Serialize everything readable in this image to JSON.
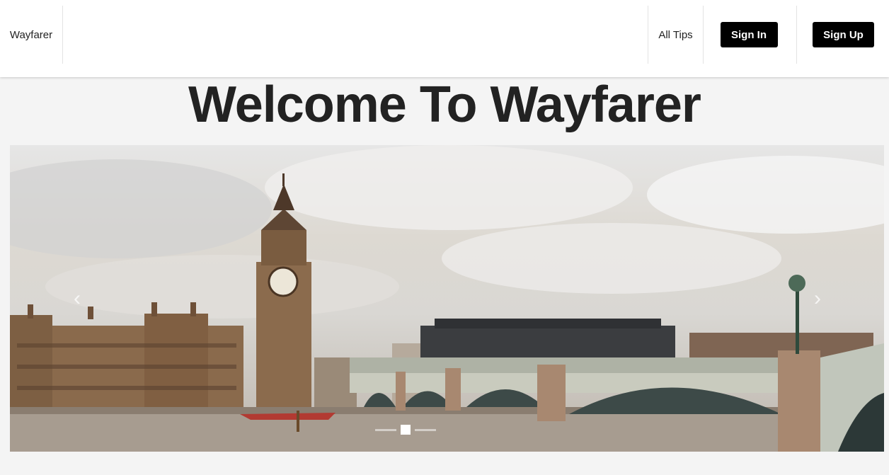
{
  "nav": {
    "brand": "Wayfarer",
    "all_tips": "All Tips",
    "sign_in": "Sign In",
    "sign_up": "Sign Up"
  },
  "hero": {
    "title": "Welcome To Wayfarer"
  },
  "carousel": {
    "prev_icon": "chevron-left-icon",
    "next_icon": "chevron-right-icon",
    "prev_glyph": "‹",
    "next_glyph": "›",
    "slide_count": 3,
    "active_index": 1,
    "image_subject": "London skyline with Big Ben, Houses of Parliament and Westminster Bridge"
  },
  "colors": {
    "button_bg": "#000000",
    "button_text": "#ffffff",
    "page_bg": "#f4f4f4",
    "navbar_bg": "#ffffff"
  }
}
